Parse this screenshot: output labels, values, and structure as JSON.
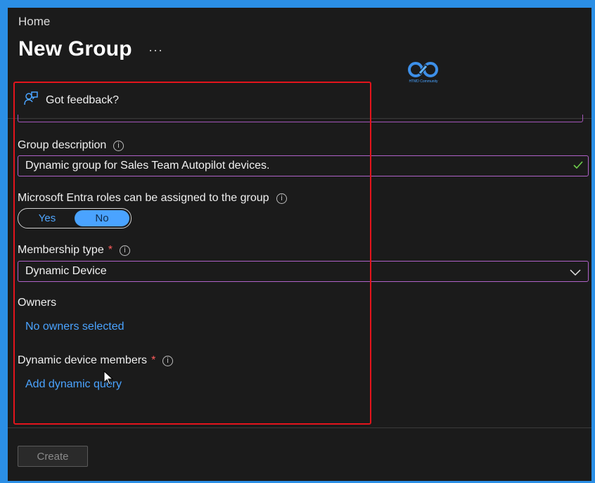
{
  "header": {
    "breadcrumb": "Home",
    "title": "New Group",
    "more_label": "···",
    "logo_text": "HTMD Community"
  },
  "feedback": {
    "label": "Got feedback?"
  },
  "form": {
    "group_description": {
      "label": "Group description",
      "value": "Dynamic group for Sales Team Autopilot devices."
    },
    "entra_roles": {
      "label": "Microsoft Entra roles can be assigned to the group",
      "options": [
        "Yes",
        "No"
      ],
      "selected": "No"
    },
    "membership_type": {
      "label": "Membership type",
      "required_mark": "*",
      "value": "Dynamic Device"
    },
    "owners": {
      "label": "Owners",
      "link": "No owners selected"
    },
    "dynamic_members": {
      "label": "Dynamic device members",
      "required_mark": "*",
      "link": "Add dynamic query"
    }
  },
  "footer": {
    "create_label": "Create"
  },
  "colors": {
    "accent": "#4aa3ff",
    "highlight": "#e3141c",
    "input_border": "#b062c8",
    "valid_check": "#6fcf4b",
    "frame_border": "#2b8fe6"
  }
}
